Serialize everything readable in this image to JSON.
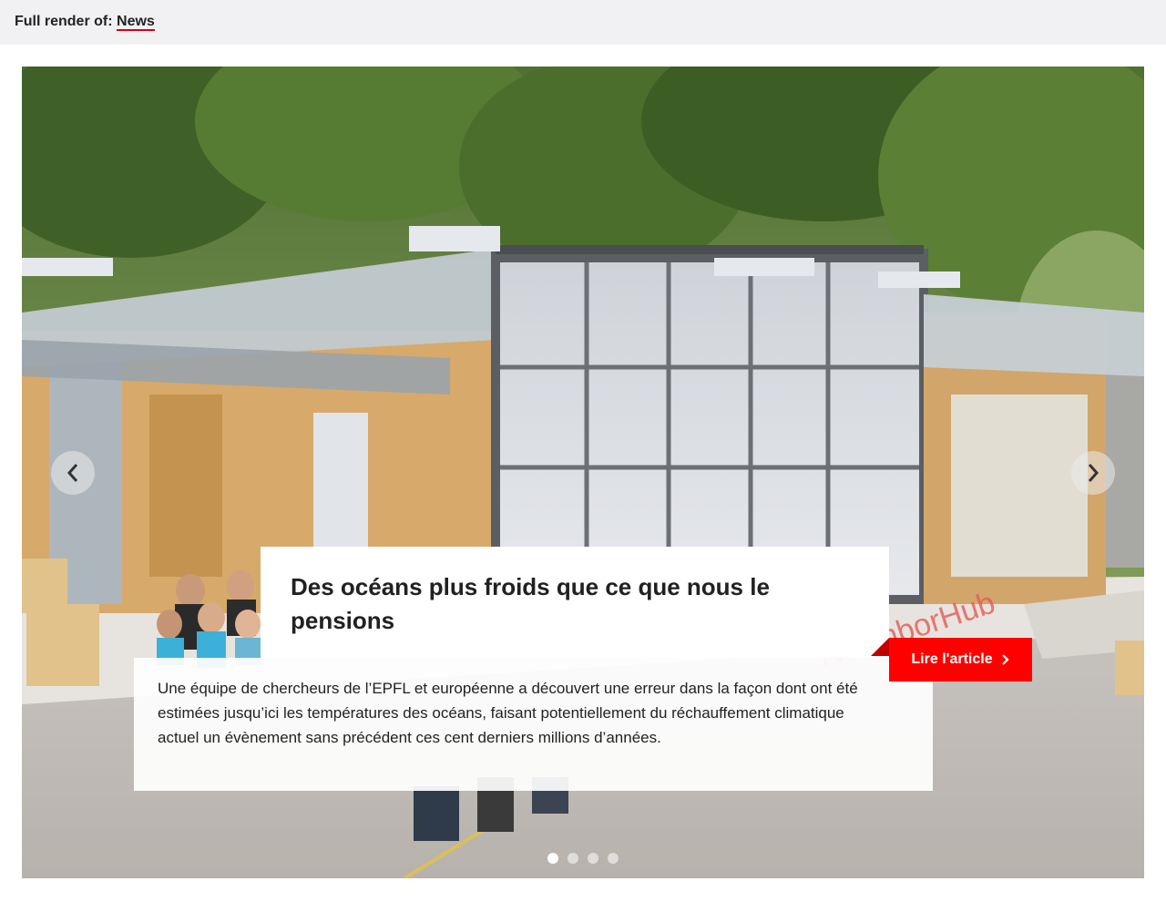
{
  "render_header": {
    "prefix": "Full render of:",
    "link_text": "News"
  },
  "carousel": {
    "slide": {
      "title": "Des océans plus froids que ce que nous le pensions",
      "description": "Une équipe de chercheurs de l’EPFL et européenne a découvert une erreur dans la façon dont ont été estimées jusqu’ici les températures des océans, faisant potentiellement du réchauffement climatique actuel un évènement sans précédent ces cent derniers millions d’années.",
      "cta_label": "Lire l'article",
      "cta_icon": "chevron-right-icon",
      "image": "Modular timber pavilion (NeighborHub) with glass facade and a group of students"
    },
    "prev_icon": "chevron-left-icon",
    "next_icon": "chevron-right-icon",
    "dots": {
      "count": 4,
      "active_index": 0
    }
  },
  "colors": {
    "accent": "#ff0000",
    "header_bg": "#f1f1f3",
    "link_underline": "#d0021b"
  }
}
